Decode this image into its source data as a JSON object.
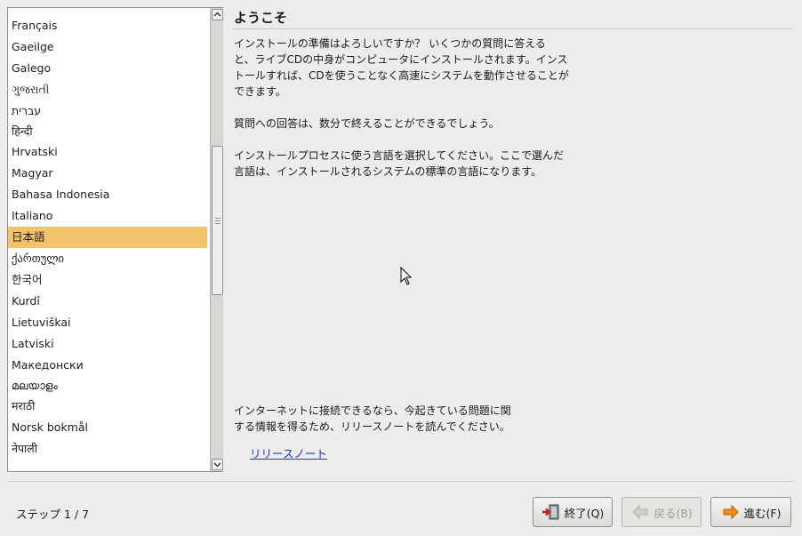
{
  "languages": [
    {
      "label": "Français",
      "selected": false
    },
    {
      "label": "Gaeilge",
      "selected": false
    },
    {
      "label": "Galego",
      "selected": false
    },
    {
      "label": "ગુજરાતી",
      "selected": false
    },
    {
      "label": "עברית",
      "selected": false
    },
    {
      "label": "हिन्दी",
      "selected": false
    },
    {
      "label": "Hrvatski",
      "selected": false
    },
    {
      "label": "Magyar",
      "selected": false
    },
    {
      "label": "Bahasa Indonesia",
      "selected": false
    },
    {
      "label": "Italiano",
      "selected": false
    },
    {
      "label": "日本語",
      "selected": true
    },
    {
      "label": "ქართული",
      "selected": false
    },
    {
      "label": "한국어",
      "selected": false
    },
    {
      "label": "Kurdî",
      "selected": false
    },
    {
      "label": "Lietuviškai",
      "selected": false
    },
    {
      "label": "Latviski",
      "selected": false
    },
    {
      "label": "Македонски",
      "selected": false
    },
    {
      "label": "മലയാളം",
      "selected": false
    },
    {
      "label": "मराठी",
      "selected": false
    },
    {
      "label": "Norsk bokmål",
      "selected": false
    },
    {
      "label": "नेपाली",
      "selected": false
    }
  ],
  "welcome": {
    "title": "ようこそ",
    "paragraph1": "インストールの準備はよろしいですか？ いくつかの質問に答える\nと、ライブCDの中身がコンピュータにインストールされます。インス\nトールすれば、CDを使うことなく高速にシステムを動作させることが\nできます。",
    "paragraph2": "質問への回答は、数分で終えることができるでしょう。",
    "paragraph3": "インストールプロセスに使う言語を選択してください。ここで選んだ\n言語は、インストールされるシステムの標準の言語になります。",
    "paragraph4": "インターネットに接続できるなら、今起きている問題に関\nする情報を得るため、リリースノートを読んでください。",
    "release_notes_link": "リリースノート"
  },
  "footer": {
    "step_label": "ステップ 1 / 7",
    "quit_label": "終了(Q)",
    "back_label": "戻る(B)",
    "forward_label": "進む(F)"
  },
  "icons": {
    "quit": "exit-door-icon",
    "back": "arrow-left-icon",
    "forward": "arrow-right-icon"
  },
  "colors": {
    "selection": "#f3c36a",
    "link": "#1c3ad1",
    "forward_arrow": "#f08a18",
    "quit_arrow": "#d01c1c"
  }
}
